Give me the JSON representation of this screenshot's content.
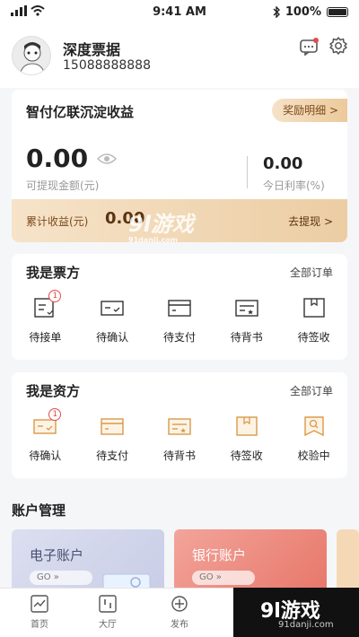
{
  "status": {
    "time": "9:41 AM",
    "battery": "100%"
  },
  "profile": {
    "name": "深度票据",
    "phone": "15088888888"
  },
  "earnings": {
    "title": "智付亿联沉淀收益",
    "reward_label": "奖励明细 >",
    "amount": "0.00",
    "amount_label": "可提现金额(元)",
    "rate": "0.00",
    "rate_label": "今日利率(%)",
    "cumulative_label": "累计收益(元)",
    "cumulative_value": "0.00",
    "withdraw_label": "去提现 >"
  },
  "ticket_orders": {
    "title": "我是票方",
    "all_label": "全部订单",
    "items": [
      {
        "label": "待接单",
        "badge": "1"
      },
      {
        "label": "待确认"
      },
      {
        "label": "待支付"
      },
      {
        "label": "待背书"
      },
      {
        "label": "待签收"
      }
    ]
  },
  "capital_orders": {
    "title": "我是资方",
    "all_label": "全部订单",
    "items": [
      {
        "label": "待确认",
        "badge": "1"
      },
      {
        "label": "待支付"
      },
      {
        "label": "待背书"
      },
      {
        "label": "待签收"
      },
      {
        "label": "校验中"
      }
    ]
  },
  "accounts": {
    "title": "账户管理",
    "cards": [
      {
        "name": "电子账户",
        "go": "GO"
      },
      {
        "name": "银行账户",
        "go": "GO"
      }
    ]
  },
  "tabs": [
    {
      "label": "首页"
    },
    {
      "label": "大厅"
    },
    {
      "label": "发布"
    }
  ],
  "watermark": {
    "text": "9l游戏",
    "site": "91danji.com"
  },
  "colors": {
    "accent": "#d99a4a",
    "badge": "#e24b4b",
    "gold_dark": "#5a3412"
  }
}
